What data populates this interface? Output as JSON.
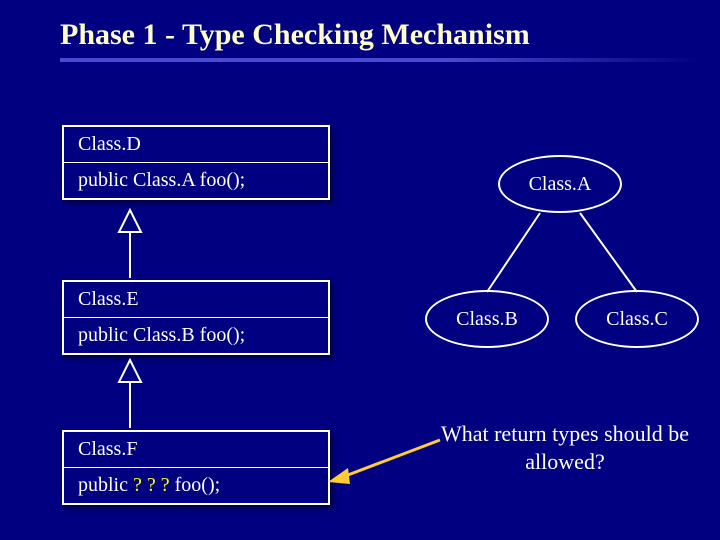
{
  "title": "Phase 1 - Type Checking Mechanism",
  "classes": {
    "d": {
      "name": "Class.D",
      "method": "public Class.A foo();"
    },
    "e": {
      "name": "Class.E",
      "method": "public Class.B foo();"
    },
    "f": {
      "name": "Class.F",
      "method_prefix": "public ",
      "method_q": "? ? ? ",
      "method_suffix": "foo();"
    }
  },
  "hierarchy": {
    "a": "Class.A",
    "b": "Class.B",
    "c": "Class.C"
  },
  "question": "What return types should be allowed?"
}
